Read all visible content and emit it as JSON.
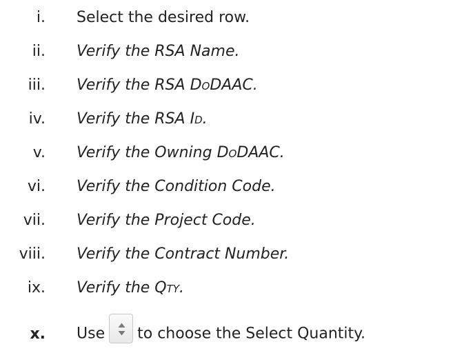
{
  "items": [
    {
      "num": "i.",
      "pre": "Select the desired row.",
      "sc": "",
      "post": ""
    },
    {
      "num": "ii.",
      "pre": "Verify the RSA Name.",
      "sc": "",
      "post": ""
    },
    {
      "num": "iii.",
      "pre": "Verify the RSA D",
      "sc": "o",
      "post": "DAAC."
    },
    {
      "num": "iv.",
      "pre": "Verify the RSA I",
      "sc": "d",
      "post": "."
    },
    {
      "num": "v.",
      "pre": "Verify the Owning D",
      "sc": "o",
      "post": "DAAC."
    },
    {
      "num": "vi.",
      "pre": "Verify the Condition Code.",
      "sc": "",
      "post": ""
    },
    {
      "num": "vii.",
      "pre": "Verify the Project Code.",
      "sc": "",
      "post": ""
    },
    {
      "num": "viii.",
      "pre": "Verify the Contract Number.",
      "sc": "",
      "post": ""
    },
    {
      "num": "ix.",
      "pre": "Verify the Q",
      "sc": "ty",
      "post": "."
    }
  ],
  "last_item": {
    "num": "x.",
    "before": "Use",
    "after": "to choose the Select Quantity.",
    "icon": "stepper-icon"
  }
}
